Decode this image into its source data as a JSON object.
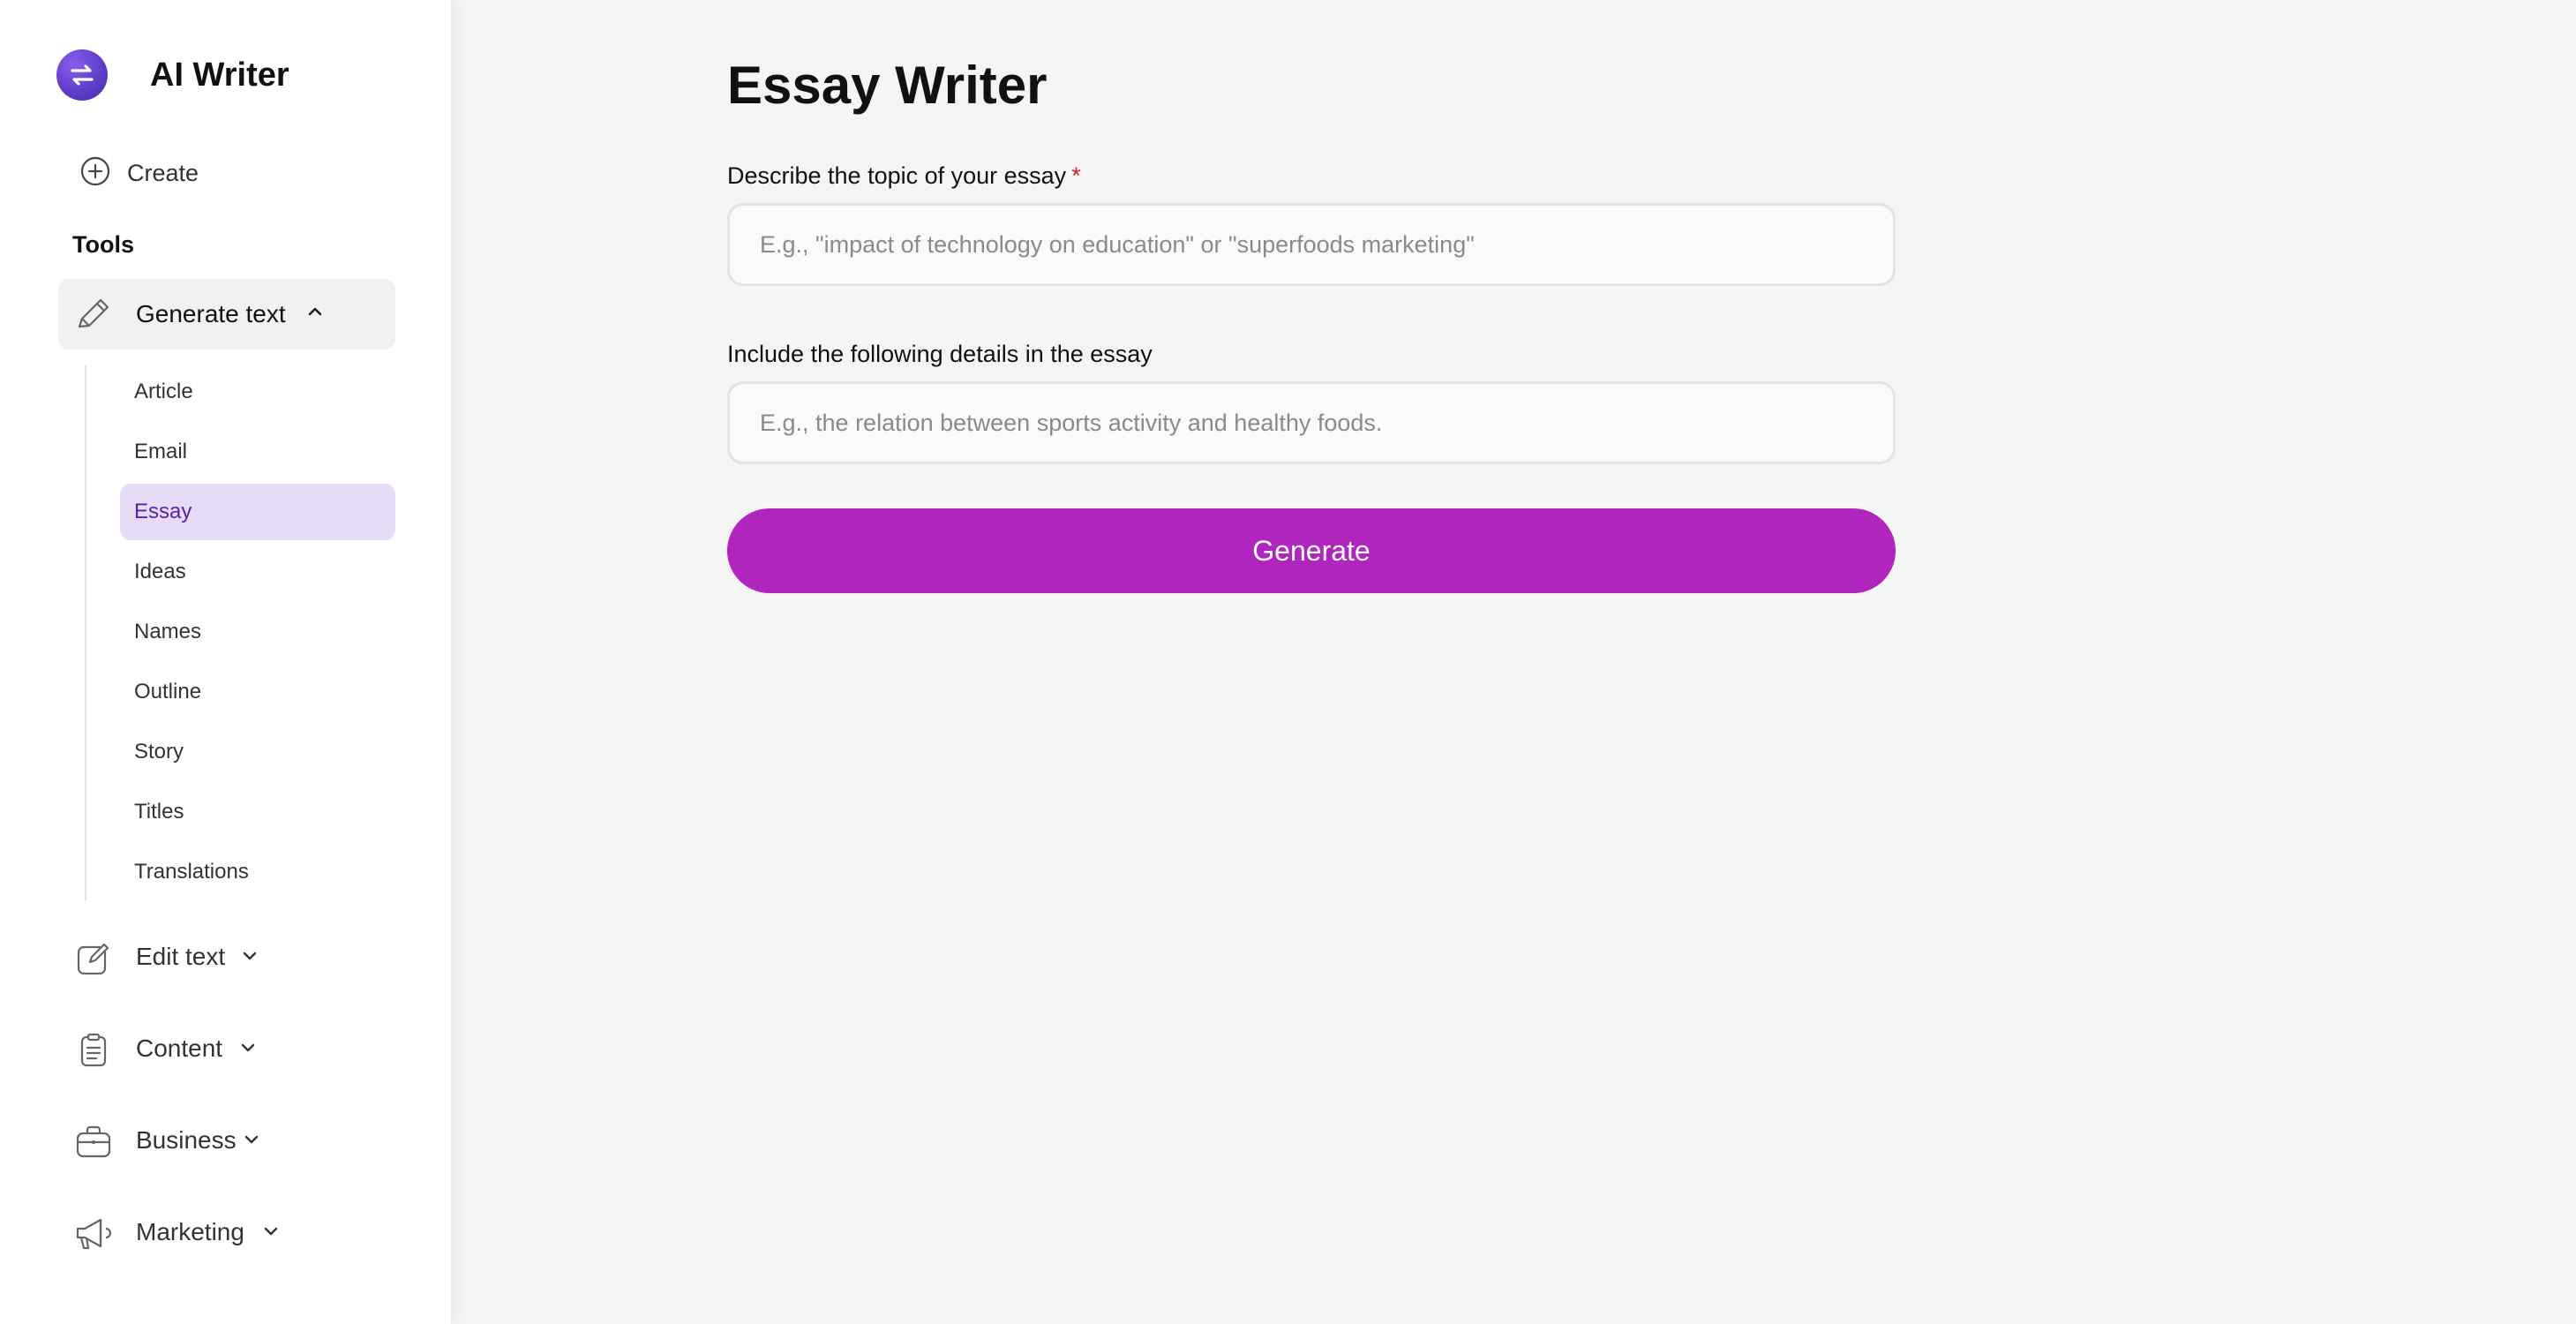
{
  "app": {
    "title": "AI Writer"
  },
  "sidebar": {
    "create_label": "Create",
    "tools_heading": "Tools",
    "active_group": {
      "label": "Generate text",
      "icon": "pen-icon",
      "expanded": true
    },
    "sub_items": [
      {
        "label": "Article",
        "active": false
      },
      {
        "label": "Email",
        "active": false
      },
      {
        "label": "Essay",
        "active": true
      },
      {
        "label": "Ideas",
        "active": false
      },
      {
        "label": "Names",
        "active": false
      },
      {
        "label": "Outline",
        "active": false
      },
      {
        "label": "Story",
        "active": false
      },
      {
        "label": "Titles",
        "active": false
      },
      {
        "label": "Translations",
        "active": false
      }
    ],
    "groups": [
      {
        "label": "Edit text",
        "icon": "edit-icon"
      },
      {
        "label": "Content",
        "icon": "clipboard-icon"
      },
      {
        "label": "Business",
        "icon": "briefcase-icon"
      },
      {
        "label": "Marketing",
        "icon": "megaphone-icon"
      }
    ]
  },
  "main": {
    "title": "Essay Writer",
    "topic": {
      "label": "Describe the topic of your essay",
      "required_mark": "*",
      "value": "",
      "placeholder": "E.g., \"impact of technology on education\" or \"superfoods marketing\""
    },
    "details": {
      "label": "Include the following details in the essay",
      "value": "",
      "placeholder": "E.g., the relation between sports activity and healthy foods."
    },
    "generate_label": "Generate"
  },
  "colors": {
    "accent": "#b025bd",
    "active_item_bg": "#e6dcf7",
    "active_item_text": "#5b1fb0",
    "required": "#d42525"
  }
}
